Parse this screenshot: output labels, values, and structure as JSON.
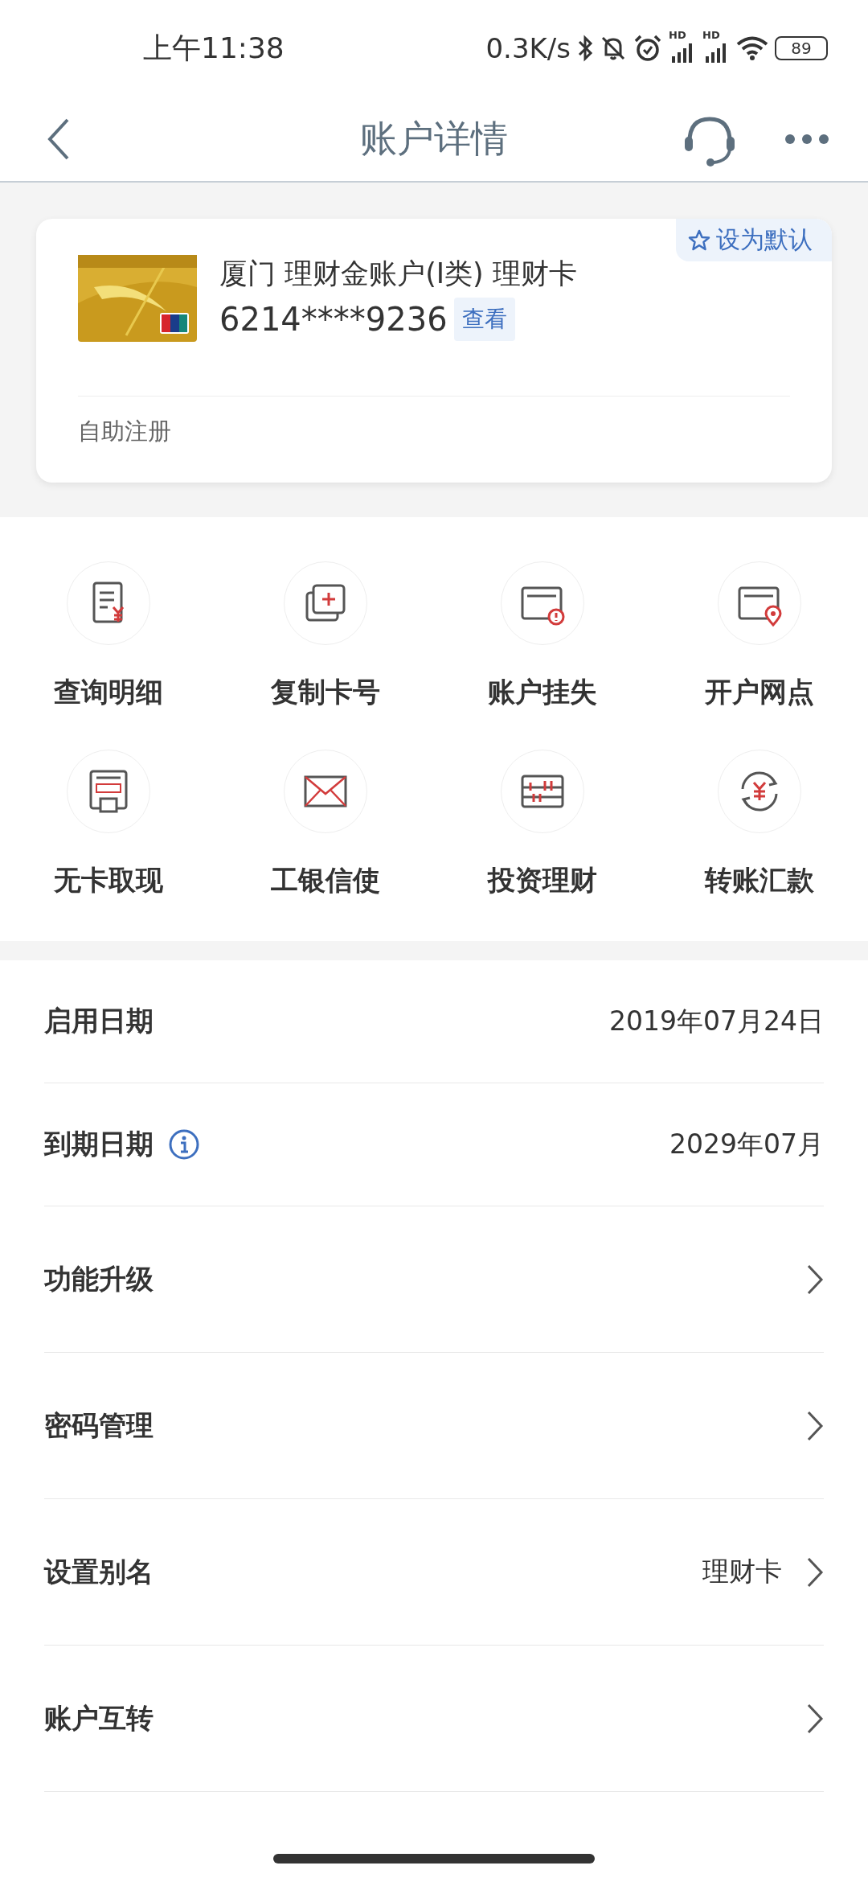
{
  "status_bar": {
    "time": "上午11:38",
    "net_speed": "0.3K/s",
    "signals": [
      {
        "label": "HD"
      },
      {
        "label": "HD"
      }
    ],
    "battery": "89"
  },
  "nav": {
    "title": "账户详情"
  },
  "card": {
    "badge": "设为默认",
    "name": "厦门 理财金账户(I类) 理财卡",
    "number": "6214****9236",
    "view": "查看",
    "note": "自助注册"
  },
  "actions": [
    {
      "label": "查询明细"
    },
    {
      "label": "复制卡号"
    },
    {
      "label": "账户挂失"
    },
    {
      "label": "开户网点"
    },
    {
      "label": "无卡取现"
    },
    {
      "label": "工银信使"
    },
    {
      "label": "投资理财"
    },
    {
      "label": "转账汇款"
    }
  ],
  "details": [
    {
      "label": "启用日期",
      "value": "2019年07月24日",
      "kind": "value"
    },
    {
      "label": "到期日期",
      "value": "2029年07月",
      "kind": "info"
    },
    {
      "label": "功能升级",
      "kind": "link"
    },
    {
      "label": "密码管理",
      "kind": "link"
    },
    {
      "label": "设置别名",
      "value": "理财卡",
      "kind": "link"
    },
    {
      "label": "账户互转",
      "kind": "link"
    }
  ]
}
